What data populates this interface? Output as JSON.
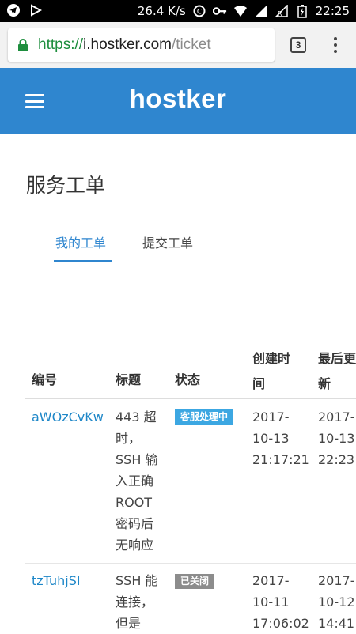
{
  "statusbar": {
    "net_speed": "26.4 K/s",
    "time": "22:25",
    "icons": [
      "telegram-icon",
      "play-icon",
      "data-saver-icon",
      "vpn-key-icon",
      "wifi-icon",
      "signal-icon",
      "signal-r-icon",
      "battery-charging-icon"
    ]
  },
  "browser": {
    "url_scheme": "https://",
    "url_host": "i.hostker.com",
    "url_path": "/ticket",
    "tab_count": "3"
  },
  "header": {
    "logo": "hostker"
  },
  "page": {
    "title": "服务工单",
    "tabs": [
      {
        "label": "我的工单",
        "active": true
      },
      {
        "label": "提交工单",
        "active": false
      }
    ]
  },
  "table": {
    "headers": {
      "id": "编号",
      "title": "标题",
      "status": "状态",
      "created_line1": "创建时",
      "created_line2": "间",
      "updated_line1": "最后更",
      "updated_line2": "新"
    },
    "rows": [
      {
        "id": "aWOzCvKw",
        "title_lines": [
          "443 超",
          "时，",
          "SSH 输",
          "入正确",
          "ROOT",
          "密码后",
          "无响应"
        ],
        "status": "客服处理中",
        "status_color": "#3ca7e2",
        "created": [
          "2017-",
          "10-13",
          "21:17:21"
        ],
        "updated": [
          "2017-",
          "10-13",
          "22:23:"
        ]
      },
      {
        "id": "tzTuhjSI",
        "title_lines": [
          "SSH 能",
          "连接，",
          "但是"
        ],
        "status": "已关闭",
        "status_color": "#8c8c8c",
        "created": [
          "2017-",
          "10-11",
          "17:06:02"
        ],
        "updated": [
          "2017-",
          "10-12",
          "14:41:"
        ]
      }
    ]
  },
  "colors": {
    "brand": "#2f86cf",
    "link": "#1e87c8"
  }
}
